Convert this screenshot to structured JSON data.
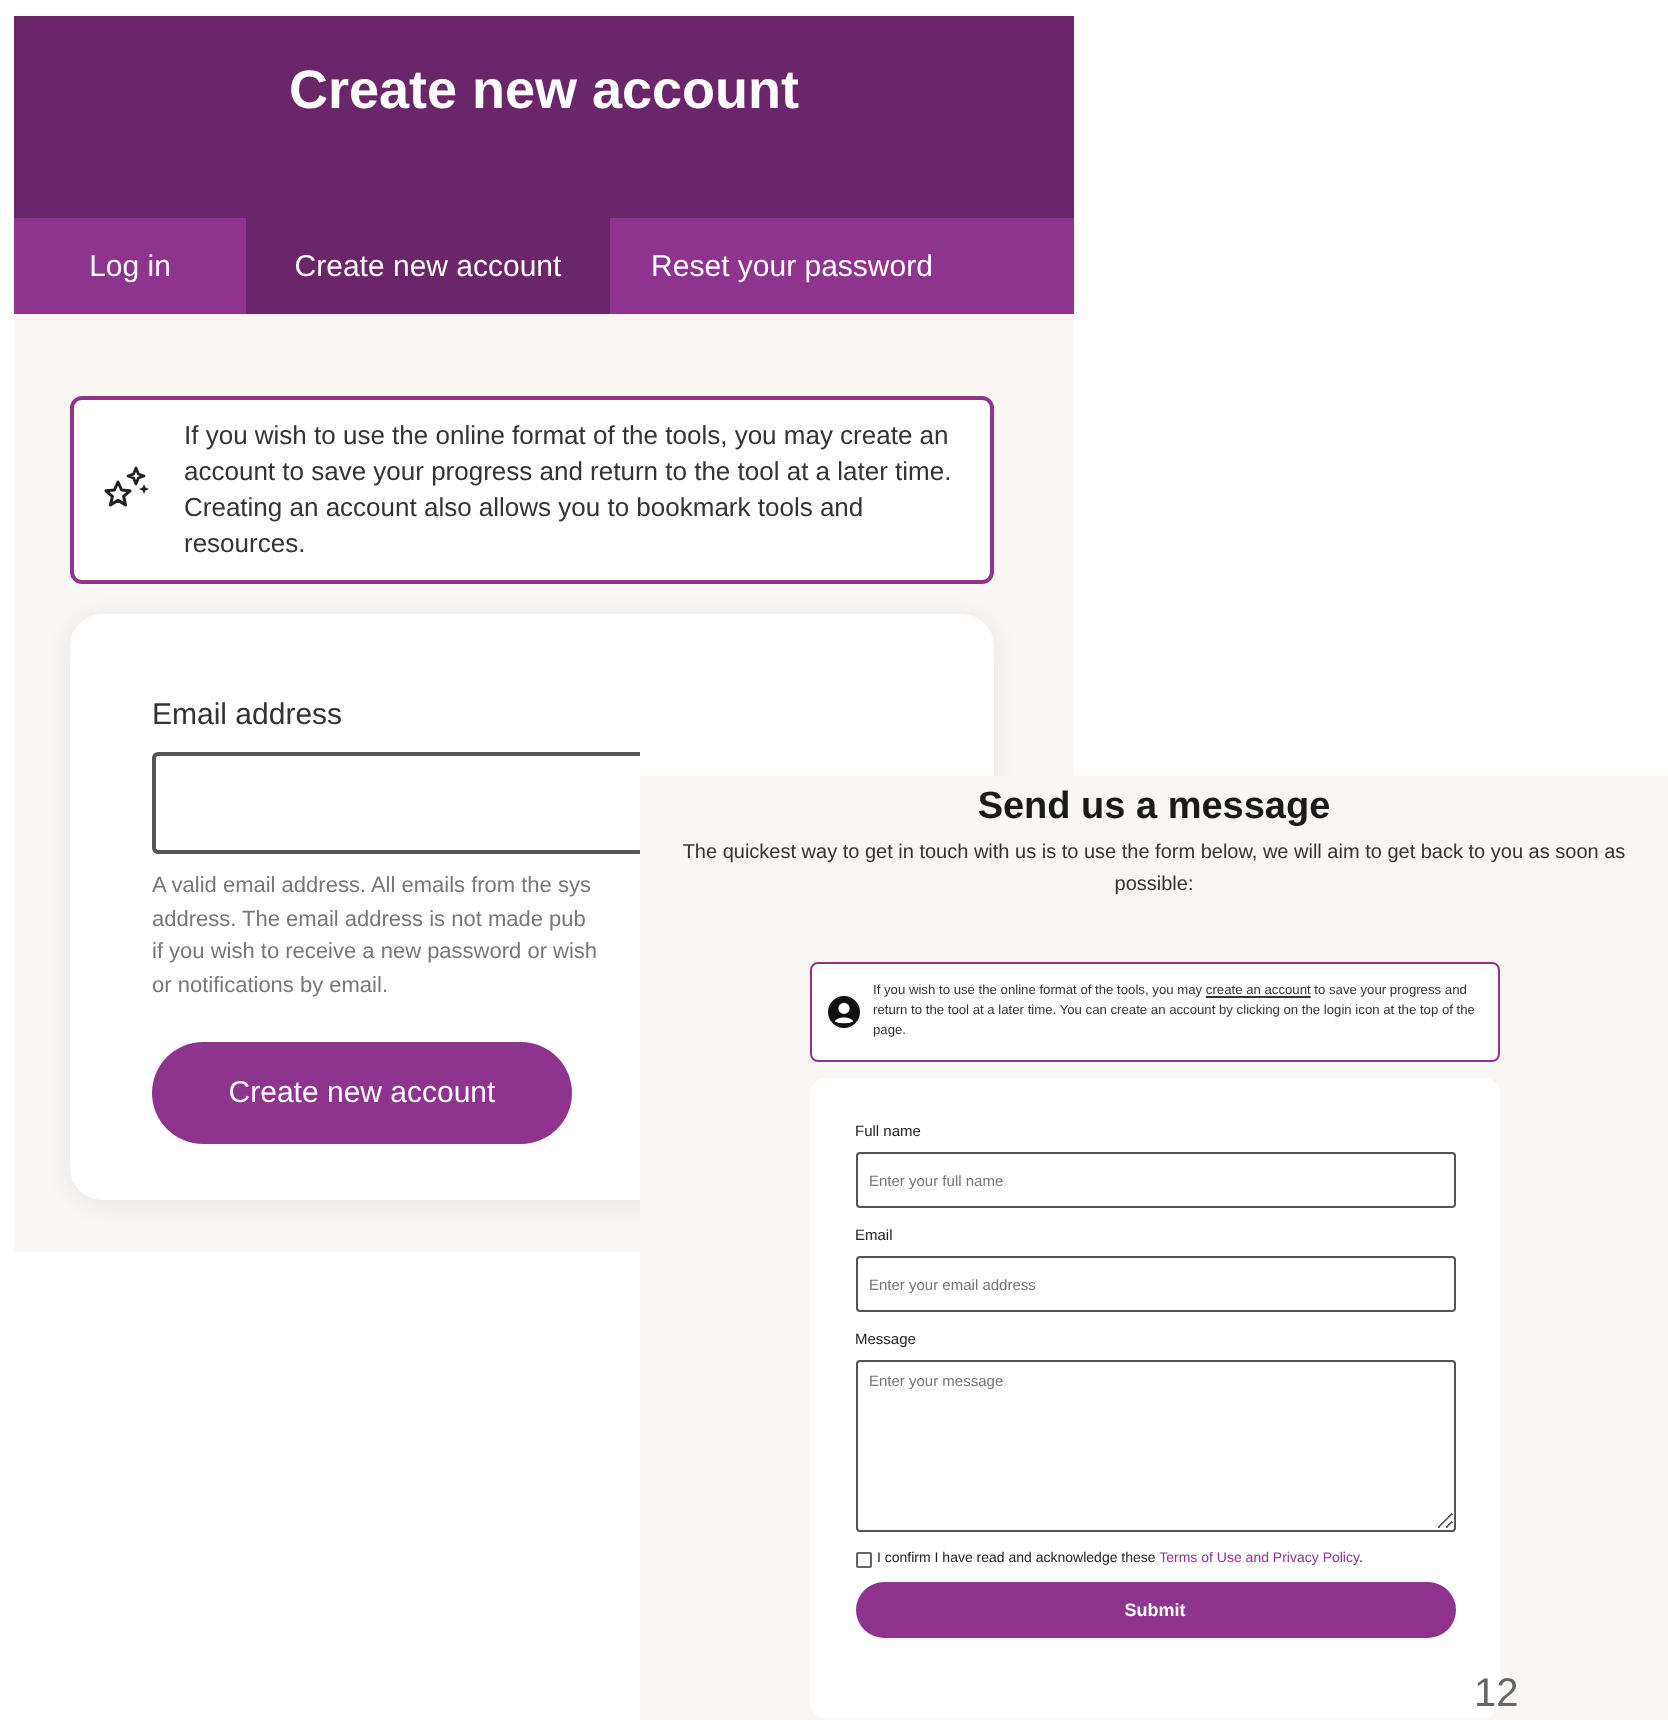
{
  "slide_number": "12",
  "account_window": {
    "title": "Create new account",
    "tabs": [
      {
        "label": "Log in",
        "selected": false
      },
      {
        "label": "Create new account",
        "selected": true
      },
      {
        "label": "Reset your password",
        "selected": false
      }
    ],
    "notice": "If you wish to use the online format of the tools, you may create an account to save your progress and return to the tool at a later time. Creating an account also allows you to bookmark tools and resources.",
    "email_label": "Email address",
    "email_help_lines": [
      "A valid email address. All emails from the sys",
      "address. The email address is not made pub",
      "if you wish to receive a new password or wish",
      "or notifications by email."
    ],
    "button": "Create new account"
  },
  "contact_window": {
    "title": "Send us a message",
    "intro": "The quickest way to get in touch with us is to use the form below, we will aim to get back to you as soon as possible:",
    "notice": {
      "before": "If you wish to use the online format of the tools, you may ",
      "link": "create an account",
      "after": " to save your progress and return to the tool at a later time. You can create an account by clicking on the login icon at the top of the page."
    },
    "fields": [
      {
        "kind": "input",
        "label": "Full name",
        "placeholder": "Enter your full name"
      },
      {
        "kind": "input",
        "label": "Email",
        "placeholder": "Enter your email address"
      },
      {
        "kind": "textarea",
        "label": "Message",
        "placeholder": "Enter your message"
      }
    ],
    "consent": {
      "checked": false,
      "text": "I confirm I have read and acknowledge these ",
      "link": "Terms of Use and Privacy Policy",
      "after": "."
    },
    "submit": "Submit"
  }
}
